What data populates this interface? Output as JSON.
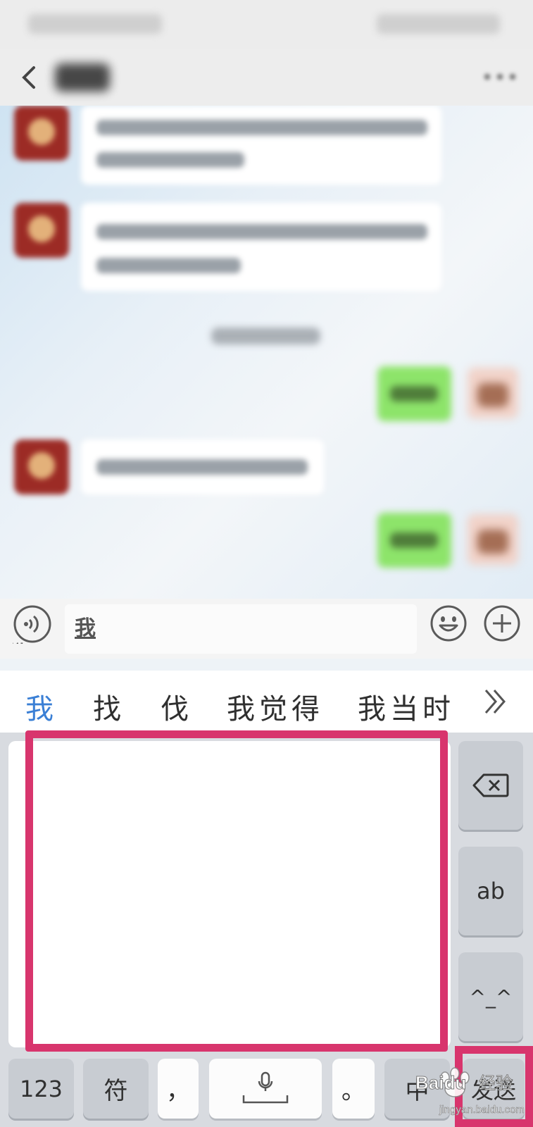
{
  "input": {
    "value": "我"
  },
  "candidates": [
    "我",
    "找",
    "伐",
    "我觉得",
    "我当时"
  ],
  "keyboard": {
    "ab_label": "ab",
    "emoticon_label": "^_^",
    "num_label": "123",
    "symbol_label": "符",
    "comma_label": "，",
    "period_label": "。",
    "lang_label": "中",
    "send_label": "发送"
  },
  "watermark": {
    "brand": "Baidu",
    "suffix": "经验",
    "url": "jingyan.baidu.com"
  },
  "colors": {
    "highlight": "#d8356d",
    "candidate_active": "#3a7fd5",
    "my_bubble": "#8de46a",
    "avatar": "#9c2b25"
  },
  "icons": {
    "back": "chevron-left-icon",
    "more": "more-icon",
    "voice": "voice-icon",
    "emoji": "emoji-icon",
    "plus": "plus-icon",
    "expand": "double-chevron-right-icon",
    "backspace": "backspace-icon",
    "mic": "mic-icon"
  }
}
